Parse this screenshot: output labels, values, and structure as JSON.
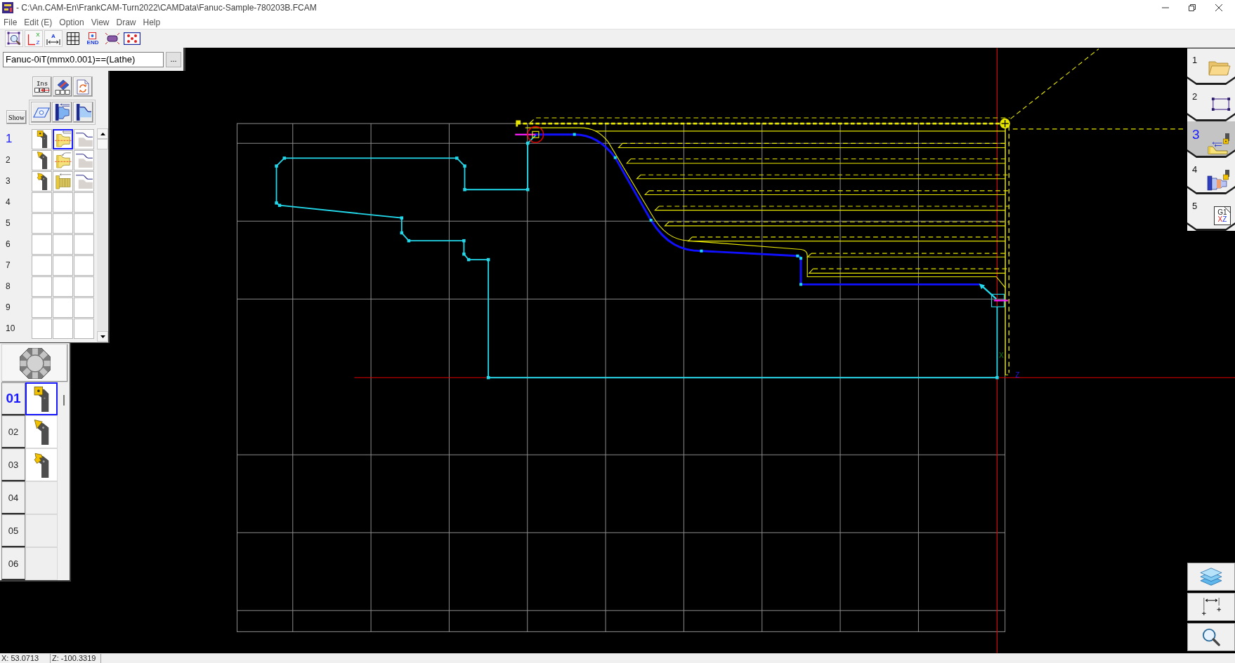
{
  "window": {
    "title": "- C:\\An.CAM-En\\FrankCAM-Turn2022\\CAMData\\Fanuc-Sample-780203B.FCAM"
  },
  "menu": [
    {
      "label": "File"
    },
    {
      "label": "Edit (E)"
    },
    {
      "label": "Option"
    },
    {
      "label": "View"
    },
    {
      "label": "Draw"
    },
    {
      "label": "Help"
    }
  ],
  "toolbar": [
    {
      "kind": "zoom-window",
      "on": true
    },
    {
      "kind": "axes",
      "on": true,
      "labels": [
        "X",
        "Z"
      ]
    },
    {
      "kind": "dimension",
      "on": true,
      "labels": [
        "A"
      ]
    },
    {
      "kind": "grid",
      "on": false
    },
    {
      "kind": "end",
      "on": false,
      "labels": [
        "END"
      ]
    },
    {
      "kind": "fit",
      "on": false
    },
    {
      "kind": "zoom-all",
      "on": false
    }
  ],
  "drawing": {
    "axis_labels": [
      "X",
      "Z"
    ]
  },
  "machine": {
    "value": "Fanuc-0iT(mmx0.001)==(Lathe)",
    "button": "..."
  },
  "operations": {
    "top_buttons": [
      {
        "kind": "insert",
        "label": "Ins"
      },
      {
        "kind": "insert-list"
      },
      {
        "kind": "refresh"
      }
    ],
    "show_button": "Show",
    "view_buttons": [
      {
        "kind": "insert-shape"
      },
      {
        "kind": "part-turning"
      },
      {
        "kind": "part-profile"
      }
    ],
    "rows": [
      {
        "number": "1",
        "selected": true,
        "cells": [
          {
            "kind": "square-insert",
            "selected": false
          },
          {
            "kind": "roughing",
            "selected": true
          },
          {
            "kind": "profile",
            "selected": false
          }
        ]
      },
      {
        "number": "2",
        "selected": false,
        "cells": [
          {
            "kind": "triangle-insert",
            "selected": false
          },
          {
            "kind": "finishing",
            "selected": false
          },
          {
            "kind": "profile",
            "selected": false
          }
        ]
      },
      {
        "number": "3",
        "selected": false,
        "cells": [
          {
            "kind": "thread-insert",
            "selected": false
          },
          {
            "kind": "threading",
            "selected": false
          },
          {
            "kind": "profile",
            "selected": false
          }
        ]
      },
      {
        "number": "4",
        "selected": false
      },
      {
        "number": "5",
        "selected": false
      },
      {
        "number": "6",
        "selected": false
      },
      {
        "number": "7",
        "selected": false
      },
      {
        "number": "8",
        "selected": false
      },
      {
        "number": "9",
        "selected": false
      },
      {
        "number": "10",
        "selected": false
      }
    ]
  },
  "turret": {
    "tools": [
      {
        "number": "01",
        "selected": true,
        "kind": "square-insert"
      },
      {
        "number": "02",
        "selected": false,
        "kind": "triangle-insert"
      },
      {
        "number": "03",
        "selected": false,
        "kind": "thread-insert"
      },
      {
        "number": "04",
        "selected": false
      },
      {
        "number": "05",
        "selected": false
      },
      {
        "number": "06",
        "selected": false
      }
    ]
  },
  "process_tabs": [
    {
      "number": "1",
      "kind": "folder",
      "selected": false
    },
    {
      "number": "2",
      "kind": "rectangle",
      "selected": false
    },
    {
      "number": "3",
      "kind": "roughing",
      "selected": true
    },
    {
      "number": "4",
      "kind": "turning",
      "selected": false
    },
    {
      "number": "5",
      "kind": "gcode",
      "selected": false,
      "labels": [
        "G1",
        "XZ"
      ]
    }
  ],
  "view_tools": [
    {
      "kind": "layers"
    },
    {
      "kind": "measure"
    },
    {
      "kind": "zoom"
    }
  ],
  "status_bar": [
    {
      "text": "X: 53.0713"
    },
    {
      "text": "Z: -100.3319"
    }
  ]
}
